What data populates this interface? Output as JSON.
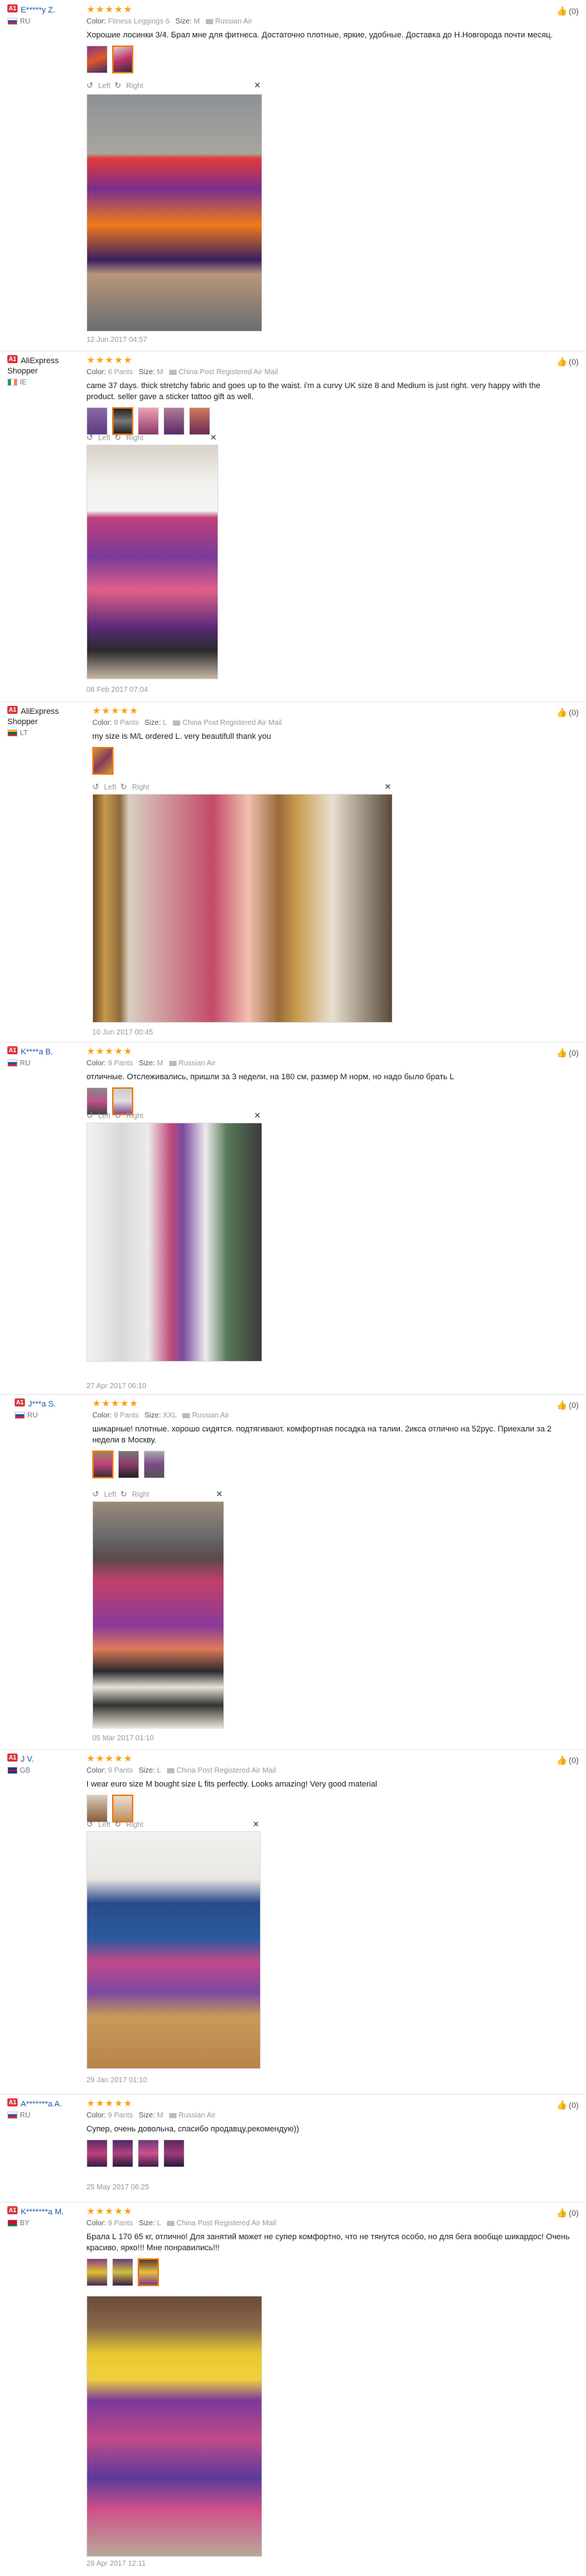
{
  "labels": {
    "color": "Color:",
    "size": "Size:",
    "rotate_left": "Left",
    "rotate_right": "Right"
  },
  "reviews": [
    {
      "user": "E*****y Z.",
      "country": "RU",
      "stars": "★★★★★",
      "color": "Fitness Leggings 6",
      "size": "M",
      "shipping": "Russian Air",
      "text": "Хорошие лосинки 3/4. Брал мне для фитнеса. Достаточно плотные, яркие, удобные. Доставка до Н.Новгорода почти месяц.",
      "date": "12 Jun 2017 04:57",
      "helpful": "(0)"
    },
    {
      "user": "AliExpress Shopper",
      "country": "IE",
      "stars": "★★★★★",
      "color": "6 Pants",
      "size": "M",
      "shipping": "China Post Registered Air Mail",
      "text": "came 37 days. thick stretchy fabric and goes up to the waist. i'm a curvy UK size 8 and Medium is just right. very happy with the product. seller gave a sticker tattoo gift as well.",
      "date": "08 Feb 2017 07:04",
      "helpful": "(0)"
    },
    {
      "user": "AliExpress Shopper",
      "country": "LT",
      "stars": "★★★★★",
      "color": "9 Pants",
      "size": "L",
      "shipping": "China Post Registered Air Mail",
      "text": "my size is M/L ordered L. very beautifull thank you",
      "date": "10 Jun 2017 00:45",
      "helpful": "(0)"
    },
    {
      "user": "K****a B.",
      "country": "RU",
      "stars": "★★★★★",
      "color": "9 Pants",
      "size": "M",
      "shipping": "Russian Air",
      "text": "отличные. Отслеживались, пришли за 3 недели, на 180 см, размер М норм, но надо было брать L",
      "date": "27 Apr 2017 06:10",
      "helpful": "(0)"
    },
    {
      "user": "J***a S.",
      "country": "RU",
      "stars": "★★★★★",
      "color": "9 Pants",
      "size": "XXL",
      "shipping": "Russian Air",
      "text": "шикарные! плотные. хорошо сидятся. подтягивают. комфортная посадка на талии. 2икса отлично на 52рус. Приехали за 2 недели в Москву.",
      "date": "05 Mar 2017 01:10",
      "helpful": "(0)"
    },
    {
      "user": "J V.",
      "country": "GB",
      "stars": "★★★★★",
      "color": "9 Pants",
      "size": "L",
      "shipping": "China Post Registered Air Mail",
      "text": "I wear euro size M bought size L fits perfectly. Looks amazing! Very good material",
      "date": "29 Jan 2017 01:10",
      "helpful": "(0)"
    },
    {
      "user": "A*******a A.",
      "country": "RU",
      "stars": "★★★★★",
      "color": "9 Pants",
      "size": "M",
      "shipping": "Russian Air",
      "text": "Супер, очень довольна, спасибо продавцу,рекомендую))",
      "date": "25 May 2017 06:25",
      "helpful": "(0)"
    },
    {
      "user": "K*******a M.",
      "country": "BY",
      "stars": "★★★★★",
      "color": "9 Pants",
      "size": "L",
      "shipping": "China Post Registered Air Mail",
      "text": "Брала L 170 65 кг, отлично! Для занятий может не супер комфортно, что не тянутся особо, но для бега вообще шикардос! Очень красиво, ярко!!! Мне понравились!!!",
      "date": "28 Apr 2017 12:11",
      "helpful": "(0)"
    }
  ]
}
